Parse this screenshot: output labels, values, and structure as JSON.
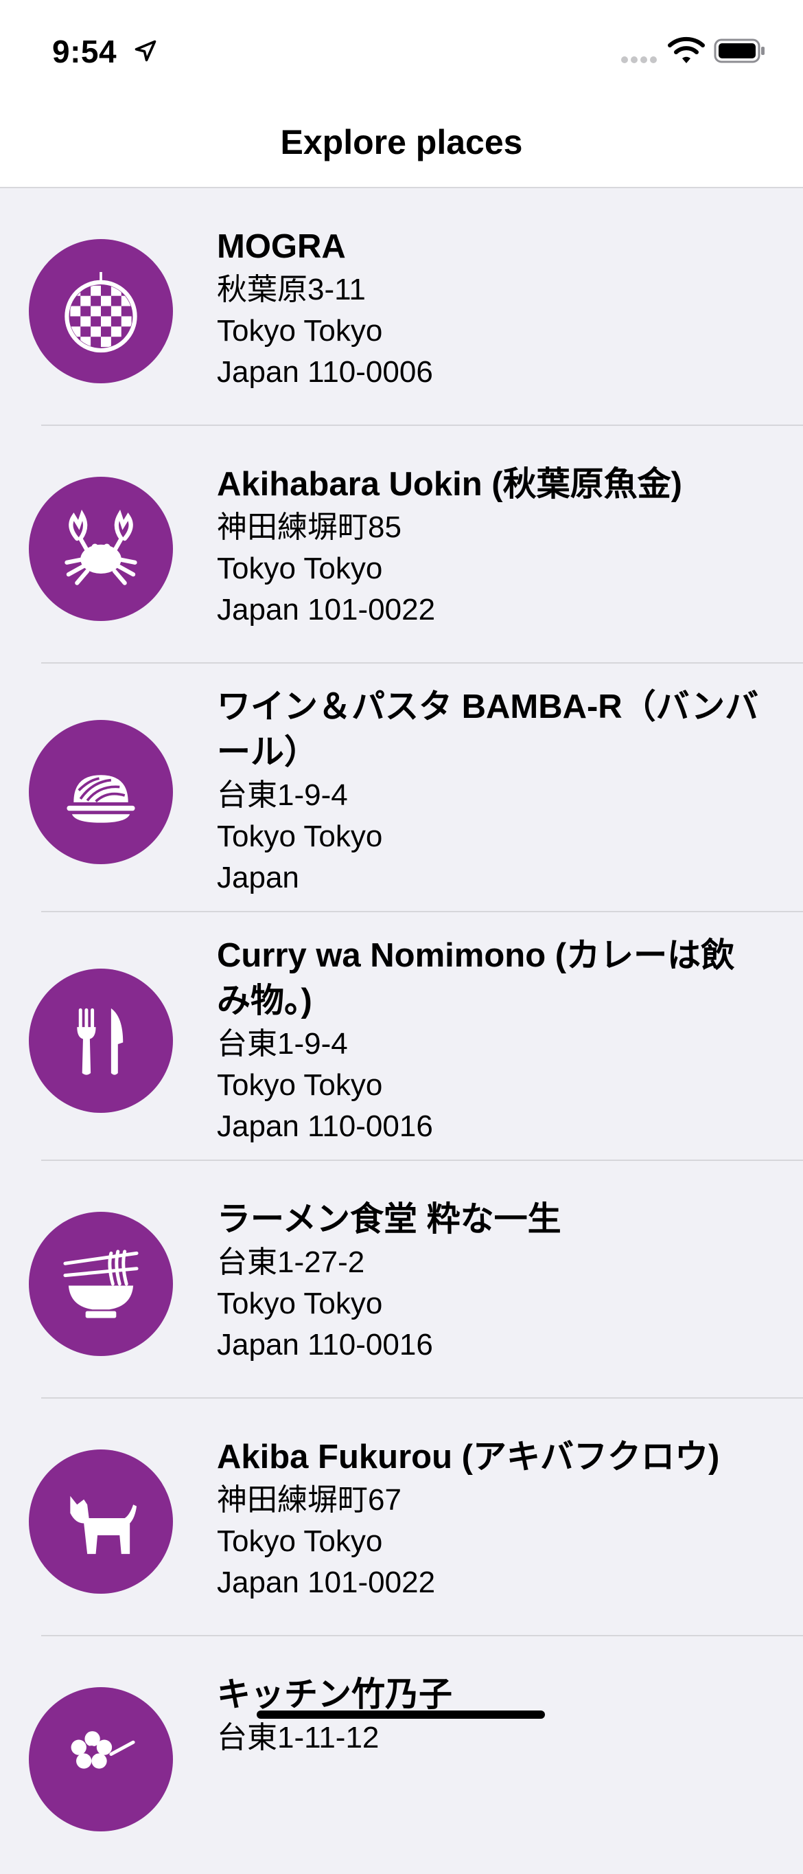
{
  "status": {
    "time": "9:54"
  },
  "nav": {
    "title": "Explore places"
  },
  "places": [
    {
      "name": "MOGRA",
      "line1": "秋葉原3-11",
      "line2": "Tokyo Tokyo",
      "line3": "Japan 110-0006",
      "icon": "disco-ball-icon"
    },
    {
      "name": "Akihabara Uokin (秋葉原魚金)",
      "line1": "神田練塀町85",
      "line2": "Tokyo Tokyo",
      "line3": "Japan 101-0022",
      "icon": "crab-icon"
    },
    {
      "name": "ワイン＆パスタ BAMBA-R（バンバール）",
      "line1": "台東1-9-4",
      "line2": "Tokyo Tokyo",
      "line3": "Japan",
      "icon": "pasta-icon"
    },
    {
      "name": "Curry wa Nomimono (カレーは飲み物。)",
      "line1": "台東1-9-4",
      "line2": "Tokyo Tokyo",
      "line3": "Japan 110-0016",
      "icon": "fork-knife-icon"
    },
    {
      "name": "ラーメン食堂 粋な一生",
      "line1": "台東1-27-2",
      "line2": "Tokyo Tokyo",
      "line3": "Japan 110-0016",
      "icon": "ramen-icon"
    },
    {
      "name": "Akiba Fukurou (アキバフクロウ)",
      "line1": "神田練塀町67",
      "line2": "Tokyo Tokyo",
      "line3": "Japan 101-0022",
      "icon": "dog-icon"
    },
    {
      "name": "キッチン竹乃子",
      "line1": "台東1-11-12",
      "line2": "",
      "line3": "",
      "icon": "flower-icon"
    }
  ],
  "colors": {
    "accent": "#862a8f",
    "background": "#f1f1f6"
  }
}
